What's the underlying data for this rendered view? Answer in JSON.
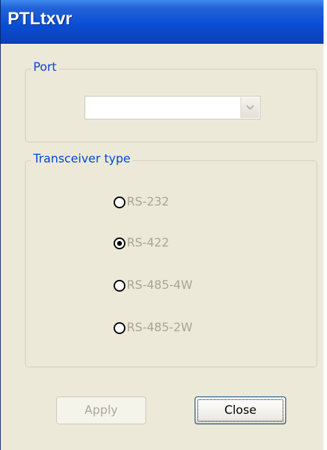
{
  "window": {
    "title": "PTLtxvr"
  },
  "port_group": {
    "label": "Port",
    "combo_value": ""
  },
  "transceiver_group": {
    "label": "Transceiver type",
    "options": [
      {
        "label": "RS-232",
        "checked": false
      },
      {
        "label": "RS-422",
        "checked": true
      },
      {
        "label": "RS-485-4W",
        "checked": false
      },
      {
        "label": "RS-485-2W",
        "checked": false
      }
    ]
  },
  "buttons": {
    "apply_label": "Apply",
    "close_label": "Close"
  },
  "icons": {
    "combo_arrow": "chevron-down-icon"
  },
  "colors": {
    "title_bar": "#0a4fd6",
    "group_label": "#0046d5",
    "dialog_background": "#ece9d8",
    "disabled_text": "#a7a597"
  }
}
